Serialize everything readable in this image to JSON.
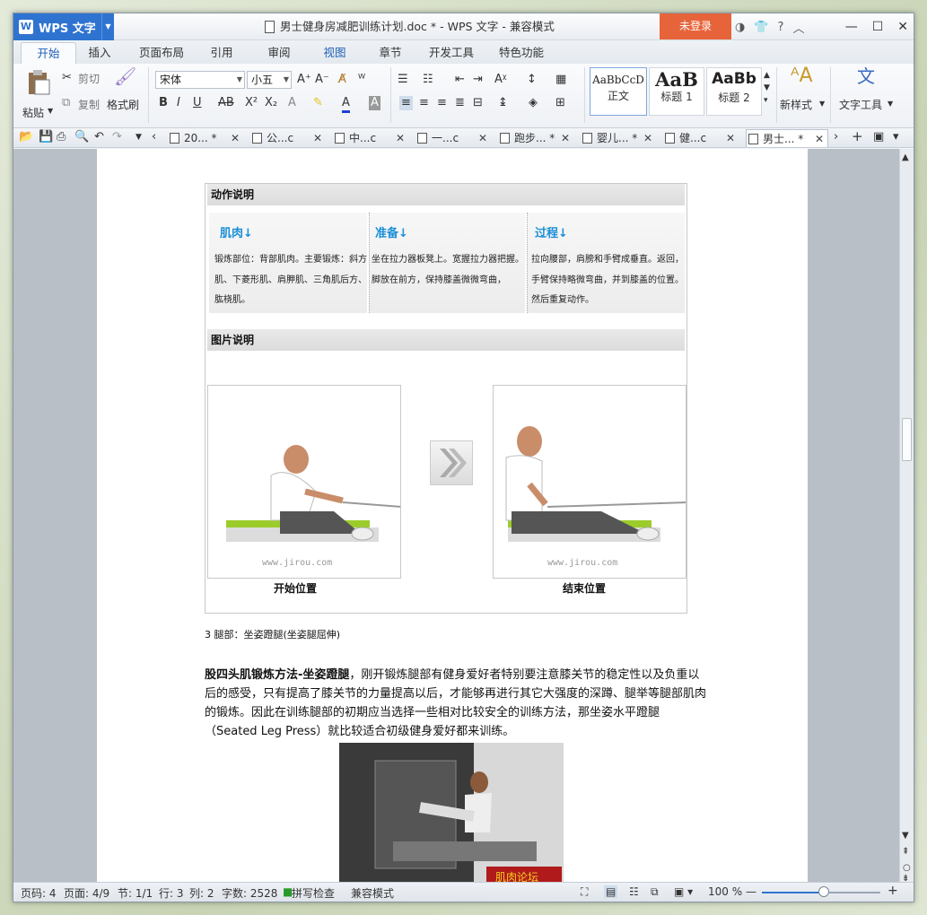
{
  "app": {
    "name": "WPS 文字",
    "window_title": "男士健身房减肥训练计划.doc * - WPS 文字 - 兼容模式",
    "login": "未登录",
    "help": "?"
  },
  "menu_tabs": [
    "开始",
    "插入",
    "页面布局",
    "引用",
    "审阅",
    "视图",
    "章节",
    "开发工具",
    "特色功能"
  ],
  "ribbon": {
    "paste": "粘贴",
    "cut": "剪切",
    "copy": "复制",
    "format_painter": "格式刷",
    "font": "宋体",
    "size": "小五",
    "styles": [
      {
        "preview": "AaBbCcD",
        "label": "正文"
      },
      {
        "preview": "AaB",
        "label": "标题 1"
      },
      {
        "preview": "AaBb",
        "label": "标题 2"
      }
    ],
    "new_style": "新样式",
    "text_tools": "文字工具"
  },
  "doc_tabs": [
    "20...",
    "公...c",
    "中...c",
    "一...c",
    "跑步...",
    "婴儿...",
    "健...c",
    "男士..."
  ],
  "doc": {
    "section1_title": "动作说明",
    "col1_title": "肌肉↓",
    "col1_text": "锻炼部位：背部肌肉。主要锻炼：斜方肌、下菱形肌、肩胛肌、三角肌后方、肱桡肌。",
    "col2_title": "准备↓",
    "col2_text": "坐在拉力器板凳上。宽握拉力器把握。脚放在前方，保持膝盖微微弯曲，",
    "col3_title": "过程↓",
    "col3_text": "拉向腰部，肩膀和手臂成垂直。返回，手臂保持略微弯曲，并到膝盖的位置。然后重复动作。",
    "section2_title": "图片说明",
    "watermark": "www.jirou.com",
    "start_caption": "开始位置",
    "end_caption": "结束位置",
    "leg_heading": "3 腿部：坐姿蹬腿(坐姿腿屈伸)",
    "para_bold": "股四头肌锻炼方法-坐姿蹬腿",
    "para_text": "，刚开锻炼腿部有健身爱好者特别要注意膝关节的稳定性以及负重以后的感受，只有提高了膝关节的力量提高以后，才能够再进行其它大强度的深蹲、腿举等腿部肌肉的锻炼。因此在训练腿部的初期应当选择一些相对比较安全的训练方法，那坐姿水平蹬腿（Seated Leg Press）就比较适合初级健身爱好都来训练。",
    "photo_logo": "肌肉论坛"
  },
  "status": {
    "page_num": "页码: 4",
    "pages": "页面: 4/9",
    "section": "节: 1/1",
    "row": "行: 3",
    "col": "列: 2",
    "words": "字数: 2528",
    "spell": "拼写检查",
    "compat": "兼容模式",
    "zoom": "100 %",
    "zoom_level": 0.52
  }
}
